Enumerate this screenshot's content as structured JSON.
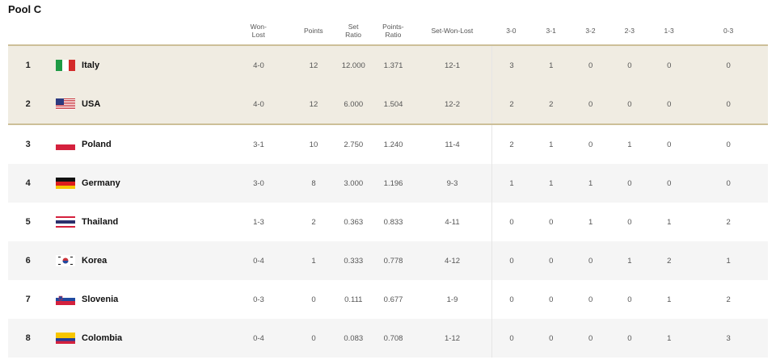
{
  "pool_title": "Pool C",
  "headers": {
    "won_lost": "Won-\nLost",
    "points": "Points",
    "set_ratio": "Set\nRatio",
    "points_ratio": "Points-\nRatio",
    "set_won_lost": "Set-Won-Lost",
    "r30": "3-0",
    "r31": "3-1",
    "r32": "3-2",
    "r23": "2-3",
    "r13": "1-3",
    "r03": "0-3"
  },
  "rows": [
    {
      "rank": "1",
      "country": "Italy",
      "flag": "italy-flag-icon",
      "won_lost": "4-0",
      "points": "12",
      "set_ratio": "12.000",
      "points_ratio": "1.371",
      "set_won_lost": "12-1",
      "r30": "3",
      "r31": "1",
      "r32": "0",
      "r23": "0",
      "r13": "0",
      "r03": "0"
    },
    {
      "rank": "2",
      "country": "USA",
      "flag": "usa-flag-icon",
      "won_lost": "4-0",
      "points": "12",
      "set_ratio": "6.000",
      "points_ratio": "1.504",
      "set_won_lost": "12-2",
      "r30": "2",
      "r31": "2",
      "r32": "0",
      "r23": "0",
      "r13": "0",
      "r03": "0"
    },
    {
      "rank": "3",
      "country": "Poland",
      "flag": "poland-flag-icon",
      "won_lost": "3-1",
      "points": "10",
      "set_ratio": "2.750",
      "points_ratio": "1.240",
      "set_won_lost": "11-4",
      "r30": "2",
      "r31": "1",
      "r32": "0",
      "r23": "1",
      "r13": "0",
      "r03": "0"
    },
    {
      "rank": "4",
      "country": "Germany",
      "flag": "germany-flag-icon",
      "won_lost": "3-0",
      "points": "8",
      "set_ratio": "3.000",
      "points_ratio": "1.196",
      "set_won_lost": "9-3",
      "r30": "1",
      "r31": "1",
      "r32": "1",
      "r23": "0",
      "r13": "0",
      "r03": "0"
    },
    {
      "rank": "5",
      "country": "Thailand",
      "flag": "thailand-flag-icon",
      "won_lost": "1-3",
      "points": "2",
      "set_ratio": "0.363",
      "points_ratio": "0.833",
      "set_won_lost": "4-11",
      "r30": "0",
      "r31": "0",
      "r32": "1",
      "r23": "0",
      "r13": "1",
      "r03": "2"
    },
    {
      "rank": "6",
      "country": "Korea",
      "flag": "korea-flag-icon",
      "won_lost": "0-4",
      "points": "1",
      "set_ratio": "0.333",
      "points_ratio": "0.778",
      "set_won_lost": "4-12",
      "r30": "0",
      "r31": "0",
      "r32": "0",
      "r23": "1",
      "r13": "2",
      "r03": "1"
    },
    {
      "rank": "7",
      "country": "Slovenia",
      "flag": "slovenia-flag-icon",
      "won_lost": "0-3",
      "points": "0",
      "set_ratio": "0.111",
      "points_ratio": "0.677",
      "set_won_lost": "1-9",
      "r30": "0",
      "r31": "0",
      "r32": "0",
      "r23": "0",
      "r13": "1",
      "r03": "2"
    },
    {
      "rank": "8",
      "country": "Colombia",
      "flag": "colombia-flag-icon",
      "won_lost": "0-4",
      "points": "0",
      "set_ratio": "0.083",
      "points_ratio": "0.708",
      "set_won_lost": "1-12",
      "r30": "0",
      "r31": "0",
      "r32": "0",
      "r23": "0",
      "r13": "1",
      "r03": "3"
    }
  ],
  "colors": {
    "qualified_bg": "#f0ece2",
    "divider": "#cdbf98",
    "alt_row_bg": "#f5f5f5"
  }
}
